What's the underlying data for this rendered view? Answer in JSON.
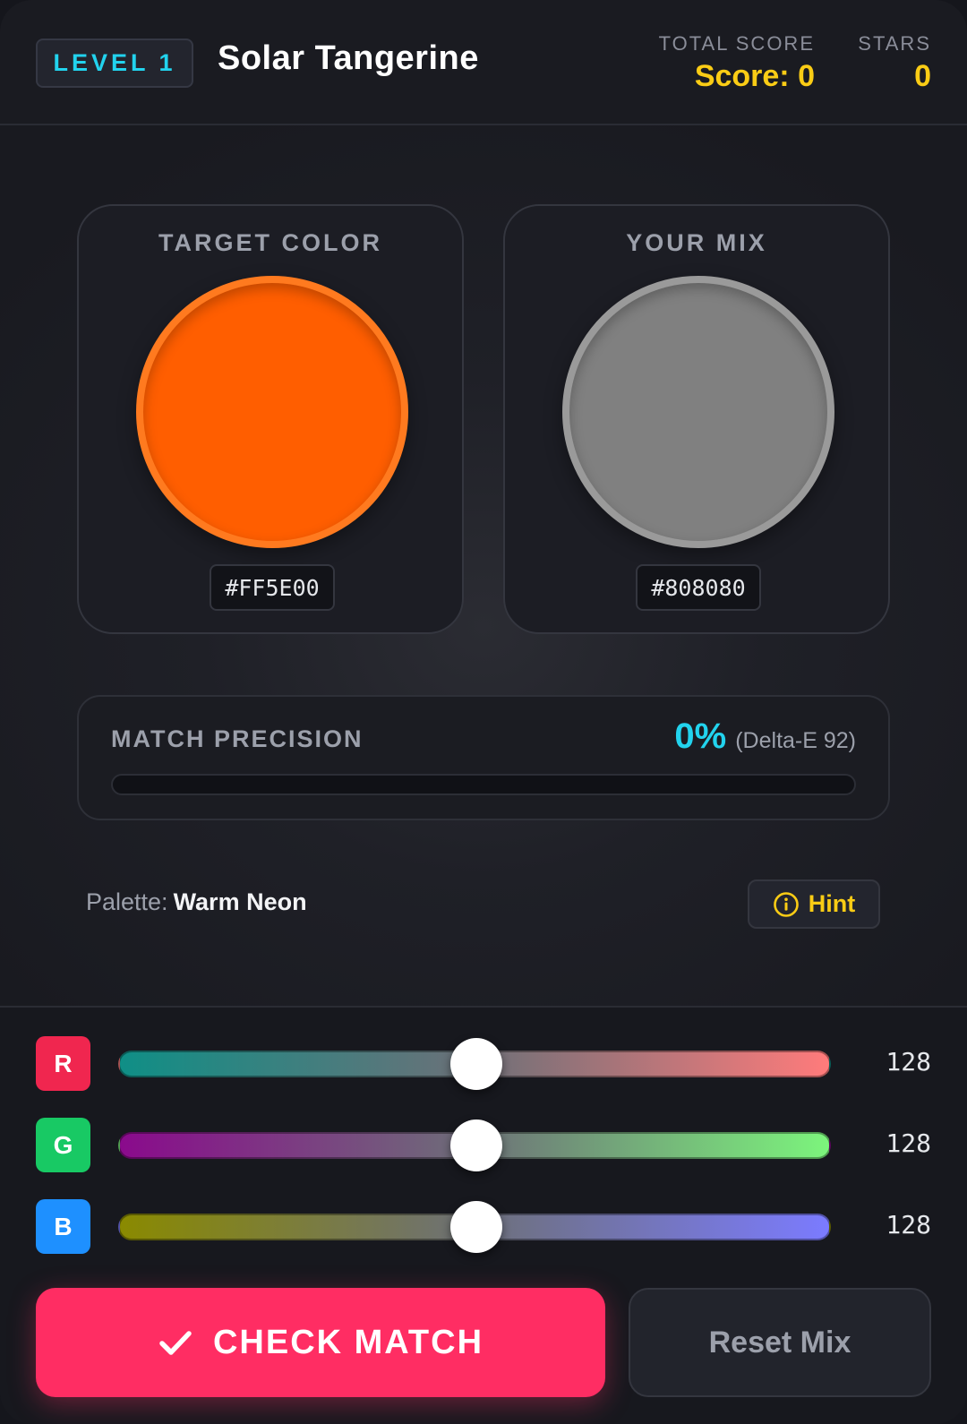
{
  "header": {
    "level_label": "LEVEL 1",
    "level_name": "Solar Tangerine",
    "total_score_label": "TOTAL SCORE",
    "total_score_value": "Score: 0",
    "stars_label": "STARS",
    "stars_value": "0"
  },
  "target": {
    "title": "TARGET COLOR",
    "hex": "#FF5E00",
    "fill": "#FF5E00",
    "ring": "#FF7A1F"
  },
  "mix": {
    "title": "YOUR MIX",
    "hex": "#808080",
    "fill": "#808080",
    "ring": "#9A9A9A"
  },
  "precision": {
    "label": "MATCH PRECISION",
    "percent_text": "0%",
    "delta_text": "(Delta-E 92)",
    "percent": 0
  },
  "palette": {
    "prefix": "Palette:",
    "name": "Warm Neon"
  },
  "hint": {
    "label": "Hint",
    "icon": "info-circle-icon"
  },
  "sliders": [
    {
      "channel": "R",
      "value": 128,
      "max": 255,
      "badge_color": "#F0264F",
      "gradient_from": "#0F8F86",
      "gradient_to": "#FF7B7B"
    },
    {
      "channel": "G",
      "value": 128,
      "max": 255,
      "badge_color": "#18C964",
      "gradient_from": "#8A0A8C",
      "gradient_to": "#7CF57C"
    },
    {
      "channel": "B",
      "value": 128,
      "max": 255,
      "badge_color": "#1E90FF",
      "gradient_from": "#8A8A00",
      "gradient_to": "#7B7BFF"
    }
  ],
  "actions": {
    "check_label": "CHECK MATCH",
    "check_icon": "checkmark-icon",
    "reset_label": "Reset Mix"
  },
  "colors": {
    "accent_cyan": "#22D3EE",
    "accent_yellow": "#FACC15",
    "primary_pink": "#FF2D63"
  }
}
